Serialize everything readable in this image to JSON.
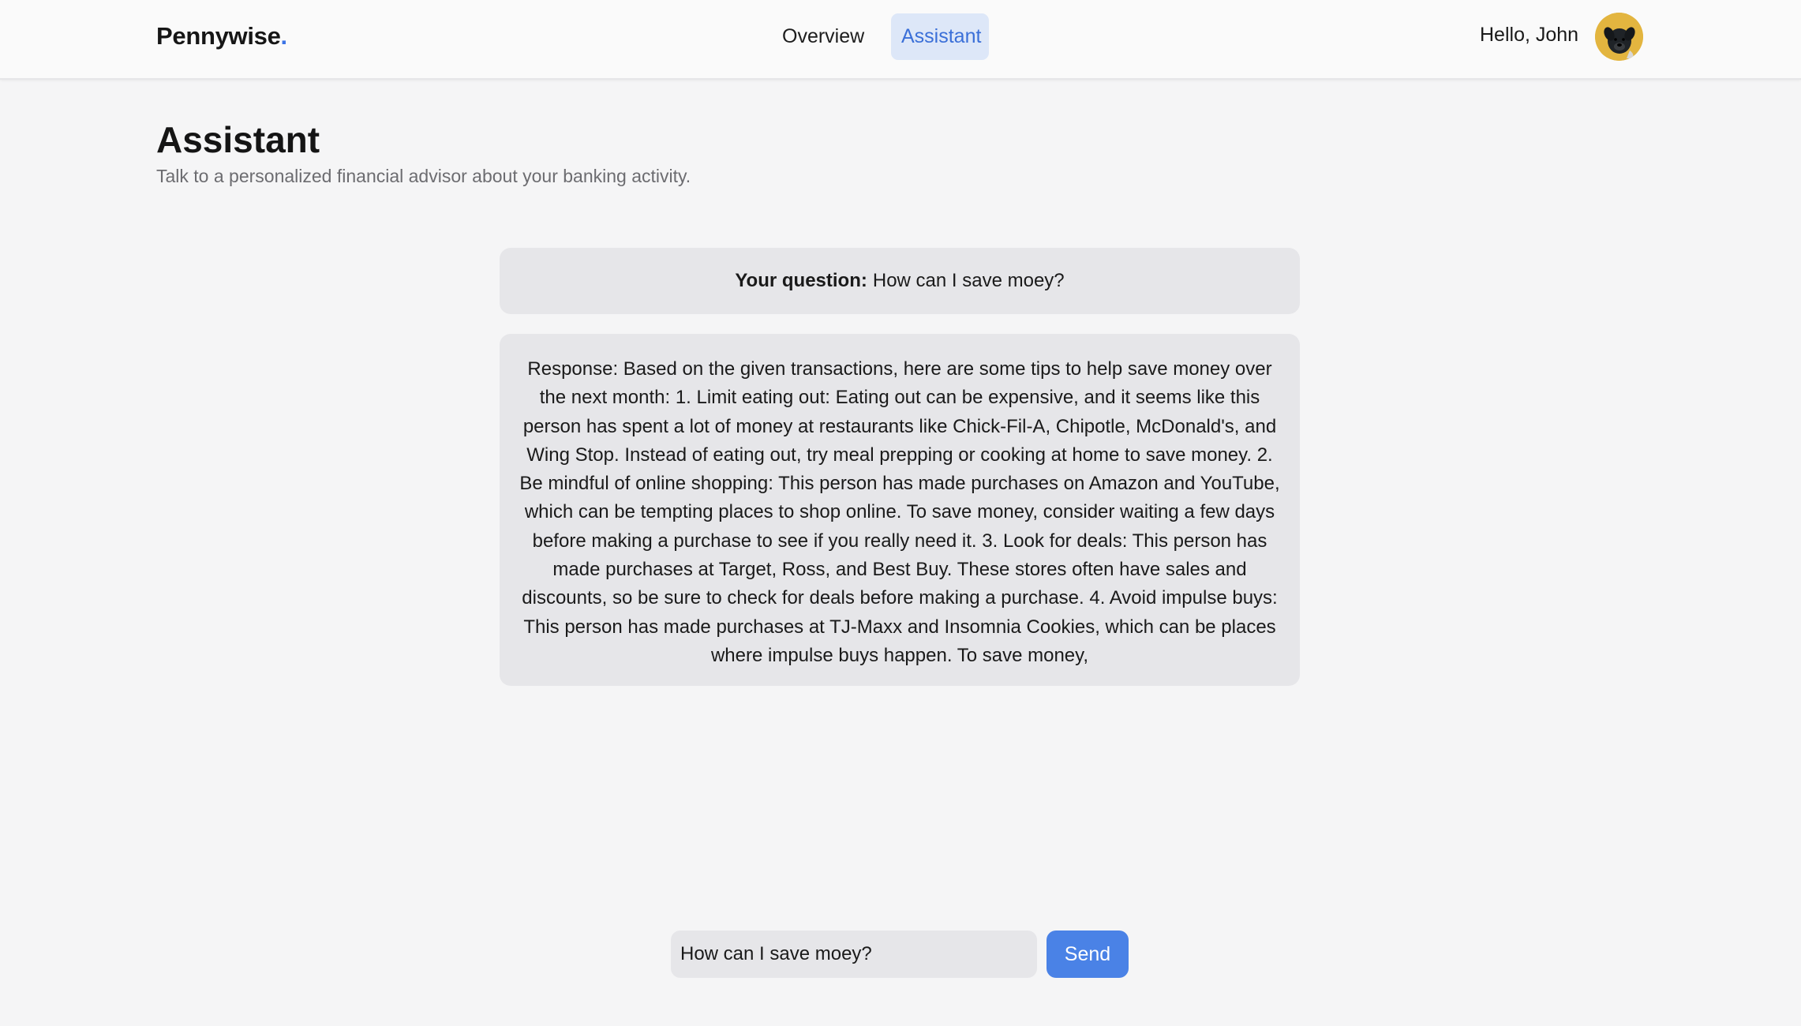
{
  "nav": {
    "brand": "Pennywise",
    "brand_dot": ".",
    "tabs": [
      {
        "label": "Overview",
        "active": false
      },
      {
        "label": "Assistant",
        "active": true
      }
    ],
    "greeting": "Hello, John",
    "avatar_icon": "dog-avatar"
  },
  "page": {
    "title": "Assistant",
    "subtitle": "Talk to a personalized financial advisor about your banking activity."
  },
  "chat": {
    "question_label": "Your question:",
    "question_text": "How can I save moey?",
    "response_text": "Response: Based on the given transactions, here are some tips to help save money over the next month: 1. Limit eating out: Eating out can be expensive, and it seems like this person has spent a lot of money at restaurants like Chick-Fil-A, Chipotle, McDonald's, and Wing Stop. Instead of eating out, try meal prepping or cooking at home to save money. 2. Be mindful of online shopping: This person has made purchases on Amazon and YouTube, which can be tempting places to shop online. To save money, consider waiting a few days before making a purchase to see if you really need it. 3. Look for deals: This person has made purchases at Target, Ross, and Best Buy. These stores often have sales and discounts, so be sure to check for deals before making a purchase. 4. Avoid impulse buys: This person has made purchases at TJ-Maxx and Insomnia Cookies, which can be places where impulse buys happen. To save money,"
  },
  "composer": {
    "input_value": "How can I save moey?",
    "send_label": "Send"
  },
  "colors": {
    "accent": "#4a82e6",
    "active_tab_bg": "#dde7f8",
    "avatar_bg": "#e3b53f"
  }
}
